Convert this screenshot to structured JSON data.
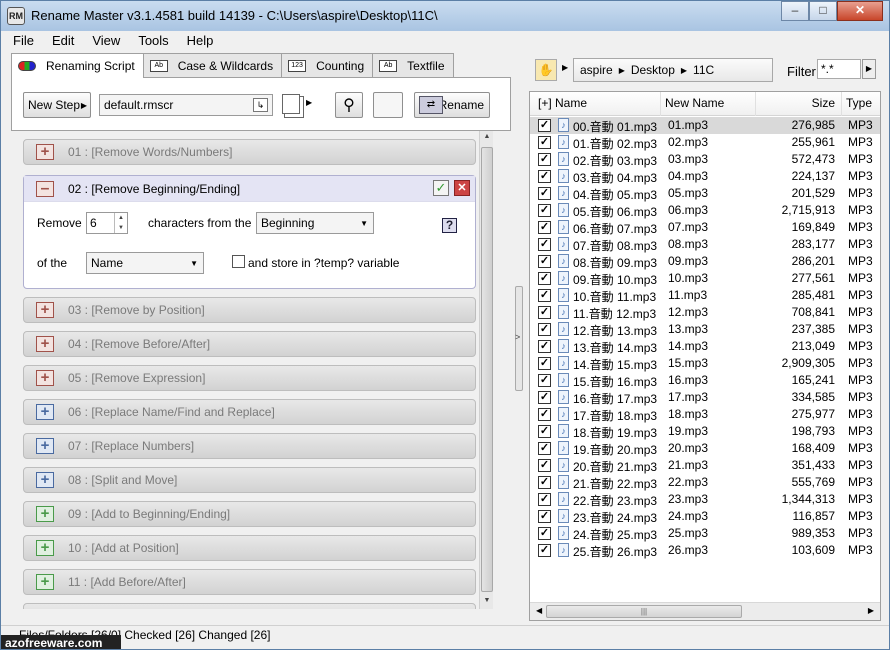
{
  "window": {
    "title": "Rename Master v3.1.4581 build 14139 - C:\\Users\\aspire\\Desktop\\11C\\",
    "app_icon": "RM"
  },
  "menu": [
    "File",
    "Edit",
    "View",
    "Tools",
    "Help"
  ],
  "tabs": [
    {
      "label": "Renaming Script",
      "icon": "rgb-icon"
    },
    {
      "label": "Case & Wildcards",
      "icon": "Ab"
    },
    {
      "label": "Counting",
      "icon": "123"
    },
    {
      "label": "Textfile",
      "icon": "Ab"
    }
  ],
  "toolbar": {
    "new_step": "New Step",
    "script_name": "default.rmscr",
    "rename": "Rename"
  },
  "steps_collapsed_top": [
    {
      "label": "01 : [Remove Words/Numbers]",
      "kind": "red"
    }
  ],
  "step_expanded": {
    "label": "02 : [Remove Beginning/Ending]",
    "remove_label": "Remove",
    "count": "6",
    "chars_label": "characters from the",
    "position": "Beginning",
    "ofthe_label": "of the",
    "target": "Name",
    "store_label": "and store in ?temp? variable",
    "help": "?"
  },
  "steps_collapsed_bottom": [
    {
      "label": "03 : [Remove by Position]",
      "kind": "red"
    },
    {
      "label": "04 : [Remove Before/After]",
      "kind": "red"
    },
    {
      "label": "05 : [Remove Expression]",
      "kind": "red"
    },
    {
      "label": "06 : [Replace Name/Find and Replace]",
      "kind": "blue"
    },
    {
      "label": "07 : [Replace Numbers]",
      "kind": "blue"
    },
    {
      "label": "08 : [Split and Move]",
      "kind": "blue"
    },
    {
      "label": "09 : [Add to Beginning/Ending]",
      "kind": "green"
    },
    {
      "label": "10 : [Add at Position]",
      "kind": "green"
    },
    {
      "label": "11 : [Add Before/After]",
      "kind": "green"
    }
  ],
  "path": {
    "crumbs": [
      "aspire",
      "Desktop",
      "11C"
    ],
    "filter_label": "Filter",
    "filter_value": "*.*"
  },
  "columns": {
    "name": "[+] Name",
    "new_name": "New Name",
    "size": "Size",
    "type": "Type"
  },
  "files": [
    {
      "name": "00.音動 01.mp3",
      "new": "01.mp3",
      "size": "276,985",
      "type": "MP3"
    },
    {
      "name": "01.音動 02.mp3",
      "new": "02.mp3",
      "size": "255,961",
      "type": "MP3"
    },
    {
      "name": "02.音動 03.mp3",
      "new": "03.mp3",
      "size": "572,473",
      "type": "MP3"
    },
    {
      "name": "03.音動 04.mp3",
      "new": "04.mp3",
      "size": "224,137",
      "type": "MP3"
    },
    {
      "name": "04.音動 05.mp3",
      "new": "05.mp3",
      "size": "201,529",
      "type": "MP3"
    },
    {
      "name": "05.音動 06.mp3",
      "new": "06.mp3",
      "size": "2,715,913",
      "type": "MP3"
    },
    {
      "name": "06.音動 07.mp3",
      "new": "07.mp3",
      "size": "169,849",
      "type": "MP3"
    },
    {
      "name": "07.音動 08.mp3",
      "new": "08.mp3",
      "size": "283,177",
      "type": "MP3"
    },
    {
      "name": "08.音動 09.mp3",
      "new": "09.mp3",
      "size": "286,201",
      "type": "MP3"
    },
    {
      "name": "09.音動 10.mp3",
      "new": "10.mp3",
      "size": "277,561",
      "type": "MP3"
    },
    {
      "name": "10.音動 11.mp3",
      "new": "11.mp3",
      "size": "285,481",
      "type": "MP3"
    },
    {
      "name": "11.音動 12.mp3",
      "new": "12.mp3",
      "size": "708,841",
      "type": "MP3"
    },
    {
      "name": "12.音動 13.mp3",
      "new": "13.mp3",
      "size": "237,385",
      "type": "MP3"
    },
    {
      "name": "13.音動 14.mp3",
      "new": "14.mp3",
      "size": "213,049",
      "type": "MP3"
    },
    {
      "name": "14.音動 15.mp3",
      "new": "15.mp3",
      "size": "2,909,305",
      "type": "MP3"
    },
    {
      "name": "15.音動 16.mp3",
      "new": "16.mp3",
      "size": "165,241",
      "type": "MP3"
    },
    {
      "name": "16.音動 17.mp3",
      "new": "17.mp3",
      "size": "334,585",
      "type": "MP3"
    },
    {
      "name": "17.音動 18.mp3",
      "new": "18.mp3",
      "size": "275,977",
      "type": "MP3"
    },
    {
      "name": "18.音動 19.mp3",
      "new": "19.mp3",
      "size": "198,793",
      "type": "MP3"
    },
    {
      "name": "19.音動 20.mp3",
      "new": "20.mp3",
      "size": "168,409",
      "type": "MP3"
    },
    {
      "name": "20.音動 21.mp3",
      "new": "21.mp3",
      "size": "351,433",
      "type": "MP3"
    },
    {
      "name": "21.音動 22.mp3",
      "new": "22.mp3",
      "size": "555,769",
      "type": "MP3"
    },
    {
      "name": "22.音動 23.mp3",
      "new": "23.mp3",
      "size": "1,344,313",
      "type": "MP3"
    },
    {
      "name": "23.音動 24.mp3",
      "new": "24.mp3",
      "size": "116,857",
      "type": "MP3"
    },
    {
      "name": "24.音動 25.mp3",
      "new": "25.mp3",
      "size": "989,353",
      "type": "MP3"
    },
    {
      "name": "25.音動 26.mp3",
      "new": "26.mp3",
      "size": "103,609",
      "type": "MP3"
    }
  ],
  "status": "Files/Folders [26/0] Checked [26] Changed [26]",
  "watermark": "azofreeware.com"
}
